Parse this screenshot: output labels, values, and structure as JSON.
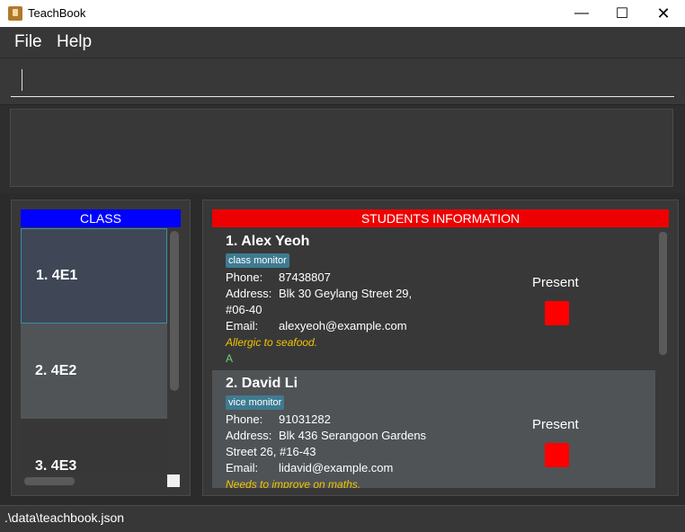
{
  "window": {
    "title": "TeachBook",
    "controls": {
      "minimize": "—",
      "maximize": "☐",
      "close": "✕"
    }
  },
  "menu": {
    "file": "File",
    "help": "Help"
  },
  "command_box": {
    "value": "",
    "placeholder": ""
  },
  "result_display": {
    "text": ""
  },
  "class_panel": {
    "header": "CLASS",
    "header_color": "#0000ff",
    "items": [
      {
        "label": "1.  4E1"
      },
      {
        "label": "2.  4E2"
      },
      {
        "label": "3.  4E3"
      }
    ]
  },
  "students_panel": {
    "header": "STUDENTS INFORMATION",
    "header_color": "#ee0000",
    "students": [
      {
        "name": "1.  Alex Yeoh",
        "tag": "class monitor",
        "phone_label": "Phone:",
        "phone": "87438807",
        "address_label": "Address:",
        "address_line1": "Blk 30 Geylang Street 29,",
        "address_line2": "#06-40",
        "email_label": "Email:",
        "email": "alexyeoh@example.com",
        "note": "Allergic to seafood.",
        "grade": "A",
        "attendance_label": "Present",
        "attendance_color": "#ff0000"
      },
      {
        "name": "2.  David Li",
        "tag": "vice monitor",
        "phone_label": "Phone:",
        "phone": "91031282",
        "address_label": "Address:",
        "address_line1": "Blk 436 Serangoon Gardens",
        "address_line2": "Street 26, #16-43",
        "email_label": "Email:",
        "email": "lidavid@example.com",
        "note": "Needs to improve on maths.",
        "attendance_label": "Present",
        "attendance_color": "#ff0000"
      }
    ]
  },
  "status_bar": {
    "path": ".\\data\\teachbook.json"
  }
}
